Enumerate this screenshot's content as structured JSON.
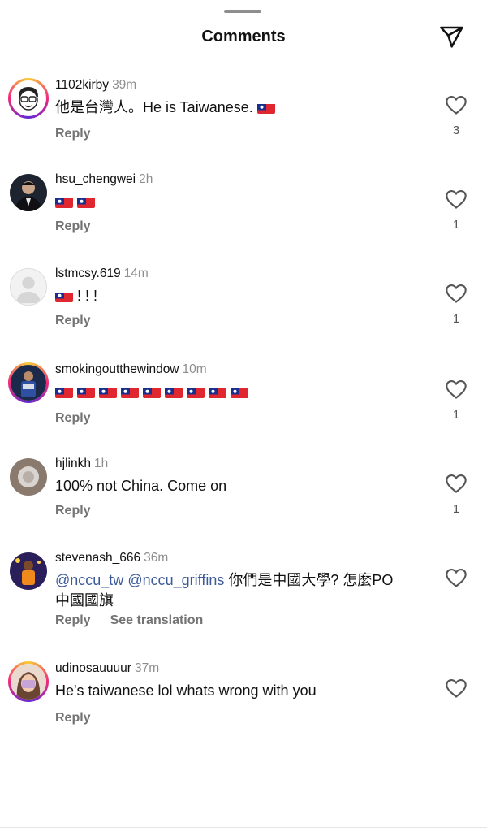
{
  "header": {
    "title": "Comments"
  },
  "comments": [
    {
      "username": "1102kirby",
      "time": "39m",
      "text": "他是台灣人。He is Taiwanese.",
      "likes": "3",
      "reply": "Reply"
    },
    {
      "username": "hsu_chengwei",
      "time": "2h",
      "likes": "1",
      "reply": "Reply"
    },
    {
      "username": "lstmcsy.619",
      "time": "14m",
      "text_suffix": "! ! !",
      "likes": "1",
      "reply": "Reply"
    },
    {
      "username": "smokingoutthewindow",
      "time": "10m",
      "likes": "1",
      "reply": "Reply"
    },
    {
      "username": "hjlinkh",
      "time": "1h",
      "text": "100% not China. Come on",
      "likes": "1",
      "reply": "Reply"
    },
    {
      "username": "stevenash_666",
      "time": "36m",
      "mention1": "@nccu_tw",
      "mention2": "@nccu_griffins",
      "text_rest": " 你們是中國大學? 怎麼PO",
      "text_line2": "中國國旗",
      "reply": "Reply",
      "see_translation": "See translation"
    },
    {
      "username": "udinosauuuur",
      "time": "37m",
      "text": "He's taiwanese lol whats wrong with you",
      "reply": "Reply"
    }
  ],
  "colors": {
    "mention": "#3c5a9a",
    "secondary": "#737373",
    "flag_red": "#e0262e",
    "flag_blue": "#1a2f8c"
  }
}
